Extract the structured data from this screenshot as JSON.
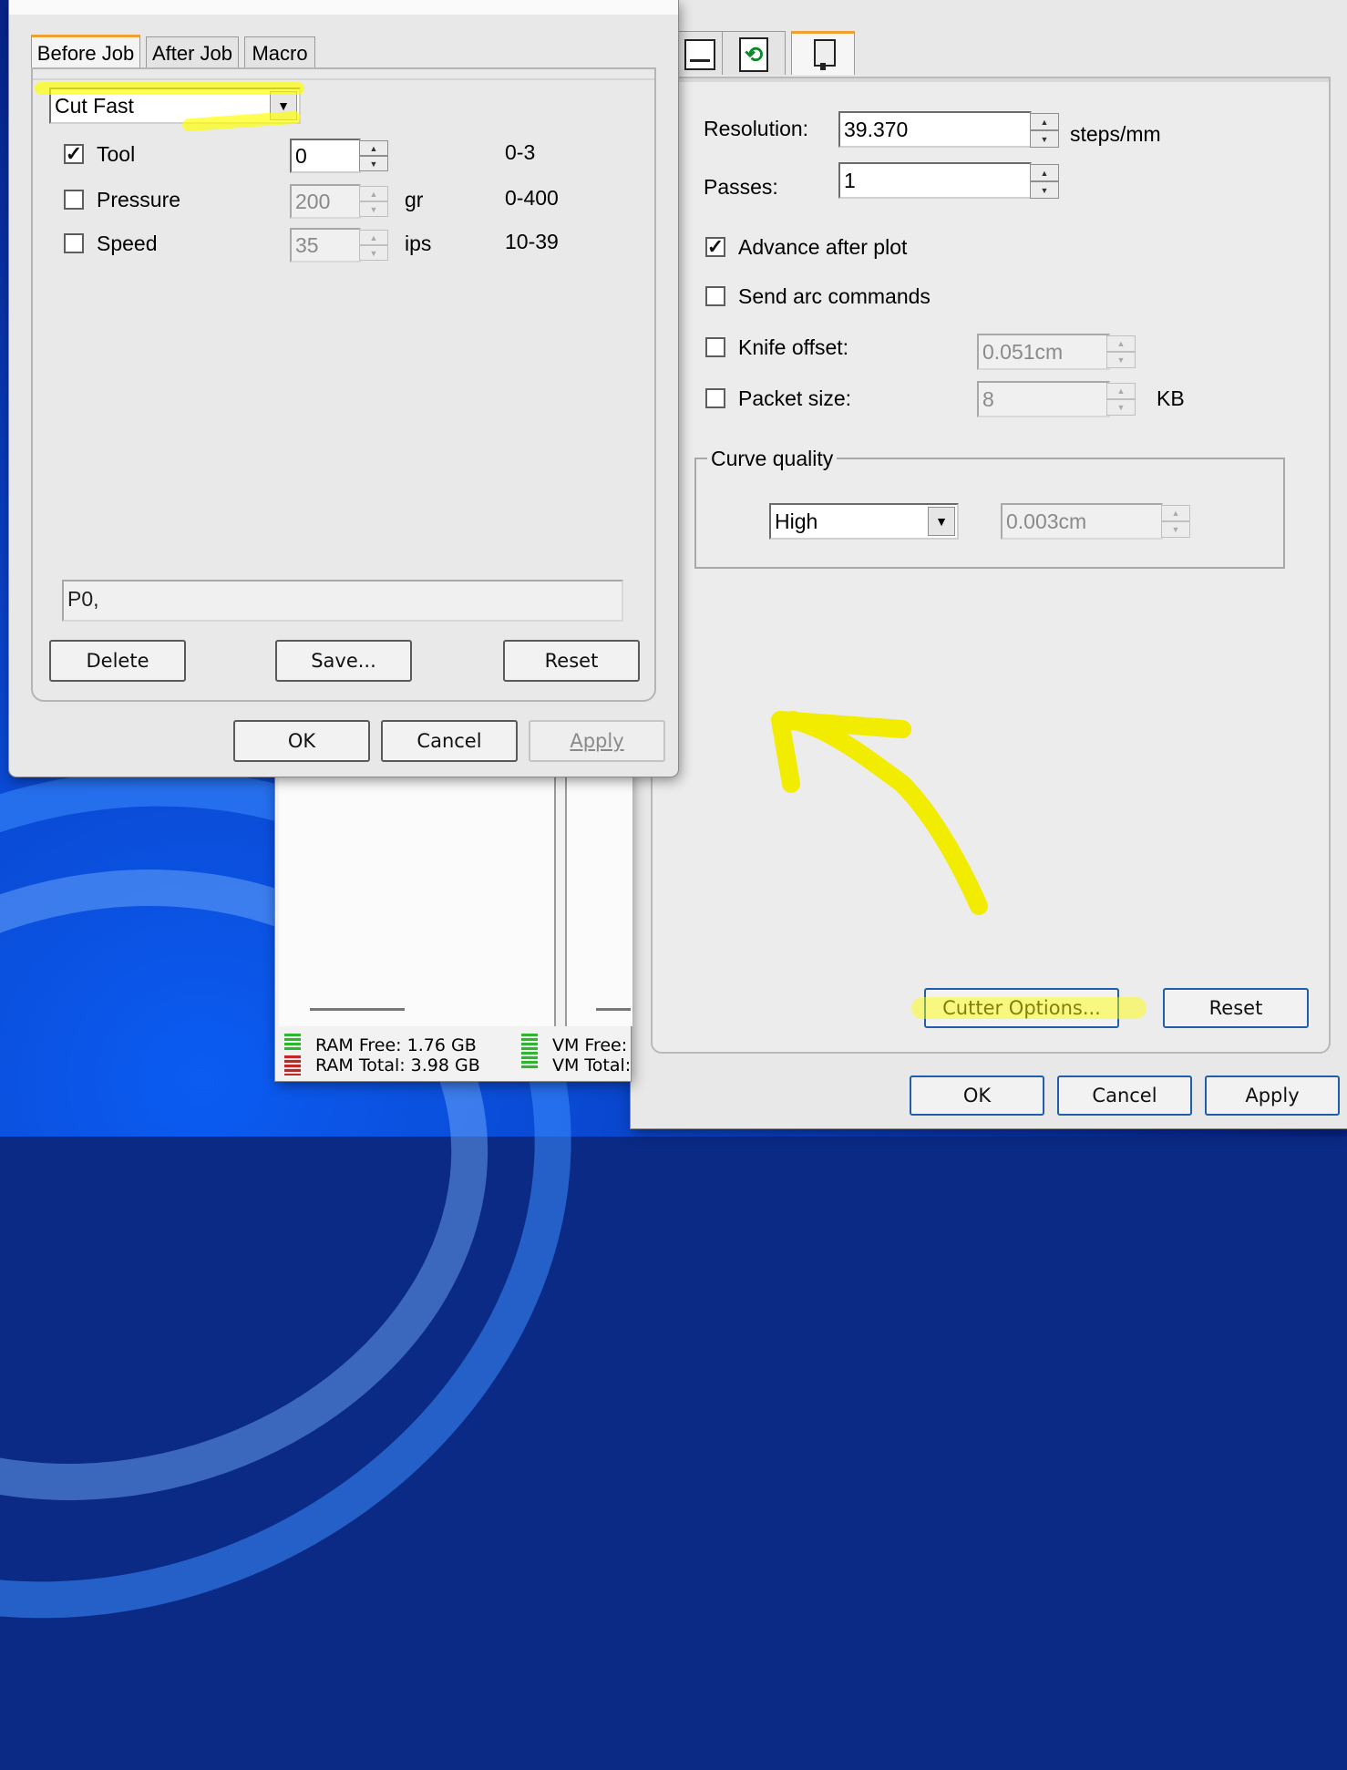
{
  "back_window": {
    "tabs": [
      {
        "icon": "plot-settings-icon"
      },
      {
        "icon": "page-refresh-icon"
      },
      {
        "icon": "cutter-knife-icon"
      }
    ],
    "resolution": {
      "label": "Resolution:",
      "value": "39.370",
      "unit": "steps/mm"
    },
    "passes": {
      "label": "Passes:",
      "value": "1"
    },
    "advance_after_plot": {
      "label": "Advance after plot",
      "checked": true
    },
    "send_arc_commands": {
      "label": "Send arc commands",
      "checked": false
    },
    "knife_offset": {
      "label": "Knife offset:",
      "checked": false,
      "value": "0.051cm"
    },
    "packet_size": {
      "label": "Packet size:",
      "checked": false,
      "value": "8",
      "unit": "KB"
    },
    "curve_quality": {
      "group_label": "Curve quality",
      "selected": "High",
      "value": "0.003cm"
    },
    "buttons": {
      "cutter_options": "Cutter Options...",
      "reset": "Reset",
      "ok": "OK",
      "cancel": "Cancel",
      "apply": "Apply"
    }
  },
  "status_window": {
    "ram_free": "RAM Free: 1.76 GB",
    "ram_total": "RAM Total: 3.98 GB",
    "vm_free": "VM Free:",
    "vm_total": "VM Total:"
  },
  "front_window": {
    "tabs": [
      "Before Job",
      "After Job",
      "Macro"
    ],
    "preset": "Cut Fast",
    "tool": {
      "label": "Tool",
      "checked": true,
      "value": "0",
      "range": "0-3"
    },
    "pressure": {
      "label": "Pressure",
      "checked": false,
      "value": "200",
      "unit": "gr",
      "range": "0-400"
    },
    "speed": {
      "label": "Speed",
      "checked": false,
      "value": "35",
      "unit": "ips",
      "range": "10-39"
    },
    "command": "P0,",
    "buttons": {
      "delete": "Delete",
      "save": "Save...",
      "reset": "Reset",
      "ok": "OK",
      "cancel": "Cancel",
      "apply": "Apply"
    }
  },
  "colors": {
    "highlight": "#ffff00",
    "tab_accent": "#f0a030",
    "button_border": "#1f5fa8"
  }
}
